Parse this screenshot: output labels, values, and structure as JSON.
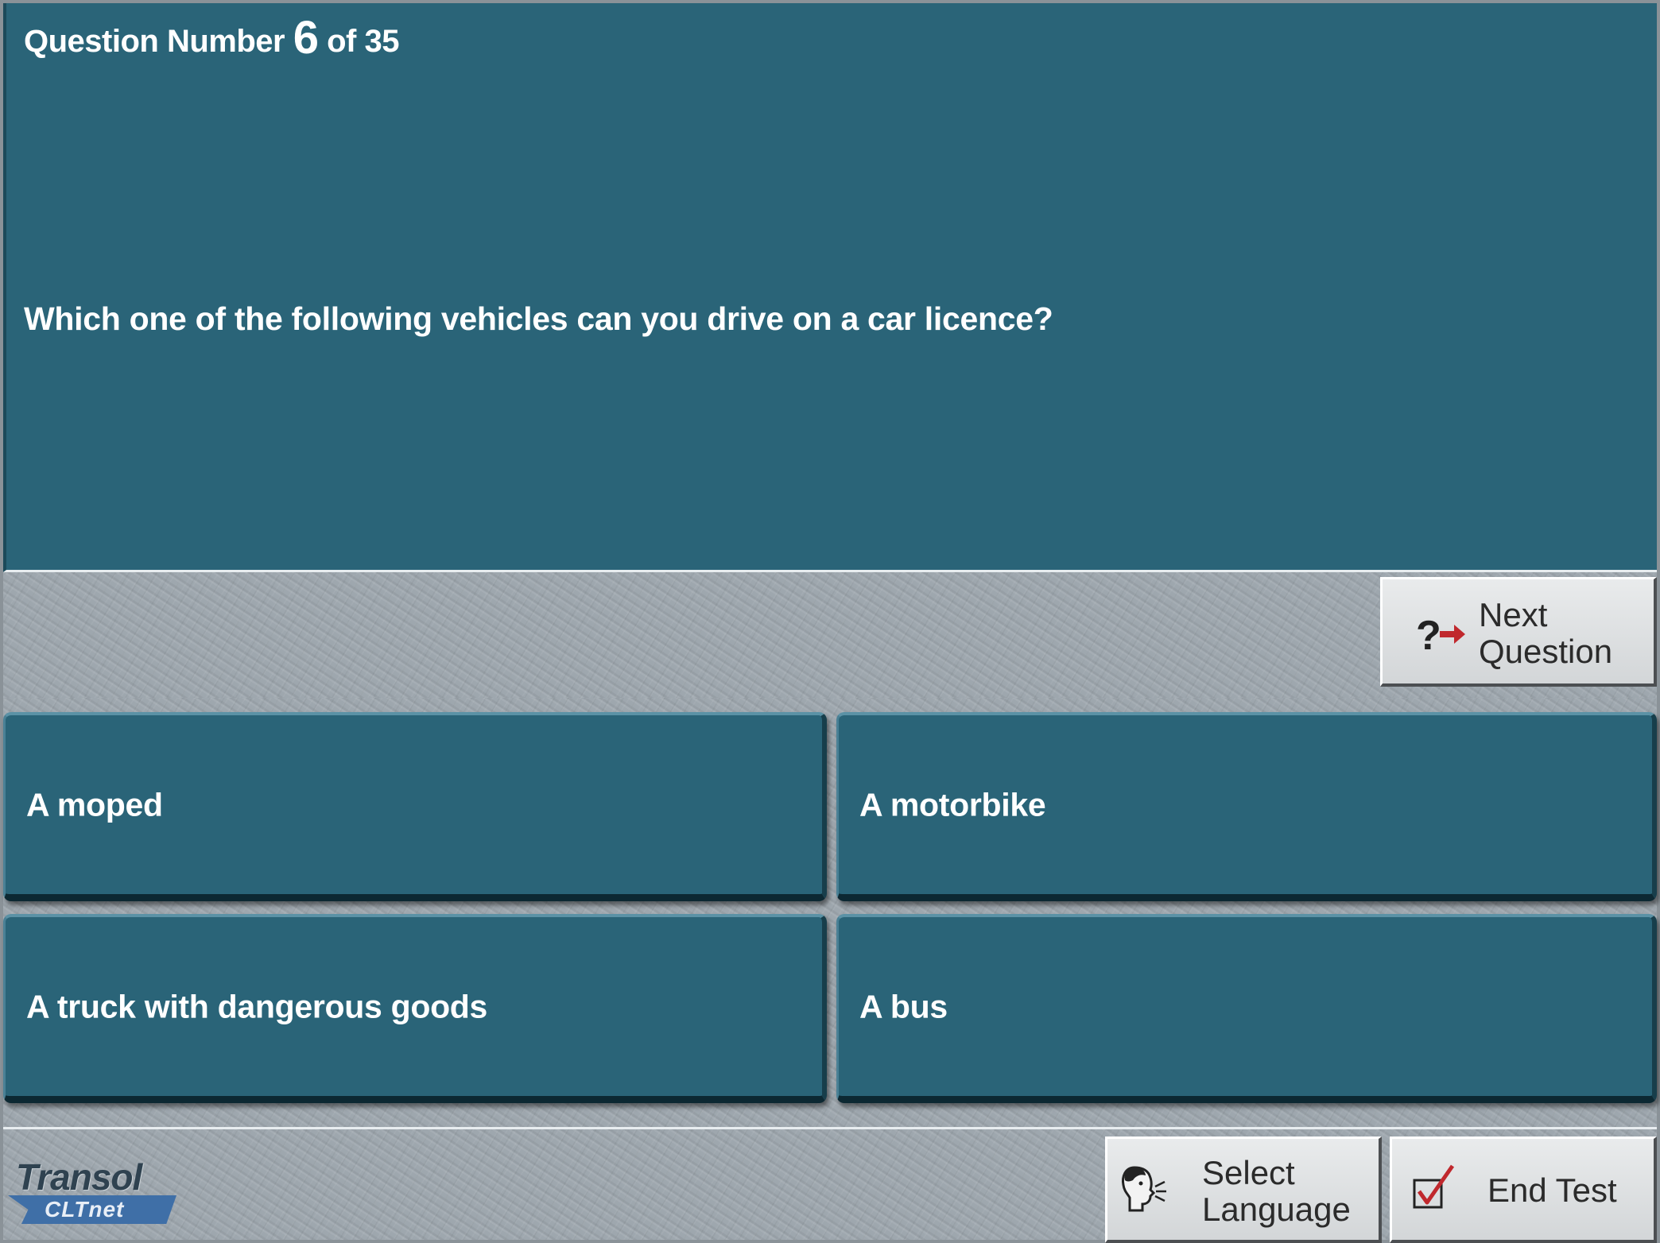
{
  "question": {
    "number_prefix": "Question Number",
    "number": "6",
    "number_suffix": "of 35",
    "text": "Which one of the following vehicles can you drive on a car licence?"
  },
  "answers": [
    {
      "label": "A moped"
    },
    {
      "label": "A motorbike"
    },
    {
      "label": "A truck with dangerous goods"
    },
    {
      "label": "A bus"
    }
  ],
  "buttons": {
    "next": {
      "line1": "Next",
      "line2": "Question",
      "icon": "question-arrow-icon"
    },
    "select_language": {
      "line1": "Select",
      "line2": "Language",
      "icon": "speaking-head-icon"
    },
    "end_test": {
      "label": "End Test",
      "icon": "checkmark-box-icon"
    }
  },
  "logo": {
    "wordmark": "Transol",
    "sub": "CLTnet"
  },
  "colors": {
    "panel": "#2a6478",
    "panel_dark": "#0c2832",
    "background": "#9ea7ae",
    "button": "#dfe1e3",
    "accent_red": "#c0282d"
  }
}
